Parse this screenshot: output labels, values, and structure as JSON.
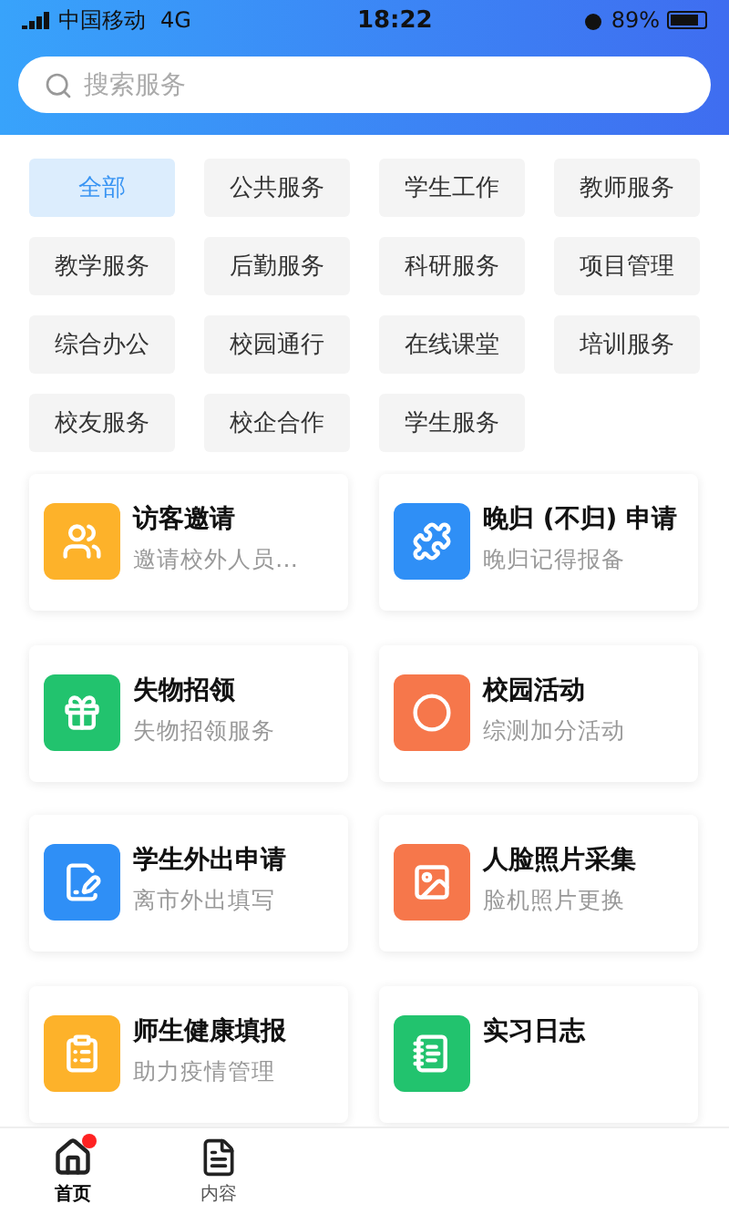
{
  "status_bar": {
    "carrier": "中国移动",
    "network": "4G",
    "time": "18:22",
    "battery": "89%"
  },
  "search": {
    "placeholder": "搜索服务"
  },
  "categories": [
    {
      "label": "全部",
      "selected": true
    },
    {
      "label": "公共服务",
      "selected": false
    },
    {
      "label": "学生工作",
      "selected": false
    },
    {
      "label": "教师服务",
      "selected": false
    },
    {
      "label": "教学服务",
      "selected": false
    },
    {
      "label": "后勤服务",
      "selected": false
    },
    {
      "label": "科研服务",
      "selected": false
    },
    {
      "label": "项目管理",
      "selected": false
    },
    {
      "label": "综合办公",
      "selected": false
    },
    {
      "label": "校园通行",
      "selected": false
    },
    {
      "label": "在线课堂",
      "selected": false
    },
    {
      "label": "培训服务",
      "selected": false
    },
    {
      "label": "校友服务",
      "selected": false
    },
    {
      "label": "校企合作",
      "selected": false
    },
    {
      "label": "学生服务",
      "selected": false
    }
  ],
  "services": [
    {
      "title": "访客邀请",
      "subtitle": "邀请校外人员…",
      "color": "#fdb22a"
    },
    {
      "title": "晚归 (不归) 申请",
      "subtitle": "晚归记得报备",
      "color": "#2f8ff6"
    },
    {
      "title": "失物招领",
      "subtitle": "失物招领服务",
      "color": "#22c36e"
    },
    {
      "title": "校园活动",
      "subtitle": "综测加分活动",
      "color": "#f6774b"
    },
    {
      "title": "学生外出申请",
      "subtitle": "离市外出填写",
      "color": "#2f8ff6"
    },
    {
      "title": "人脸照片采集",
      "subtitle": "脸机照片更换",
      "color": "#f6774b"
    },
    {
      "title": "师生健康填报",
      "subtitle": "助力疫情管理",
      "color": "#fdb22a"
    },
    {
      "title": "实习日志",
      "color": "#22c36e"
    }
  ],
  "tab_bar": [
    {
      "label": "首页",
      "selected": true,
      "badge": true
    },
    {
      "label": "内容",
      "selected": false,
      "badge": false
    }
  ]
}
